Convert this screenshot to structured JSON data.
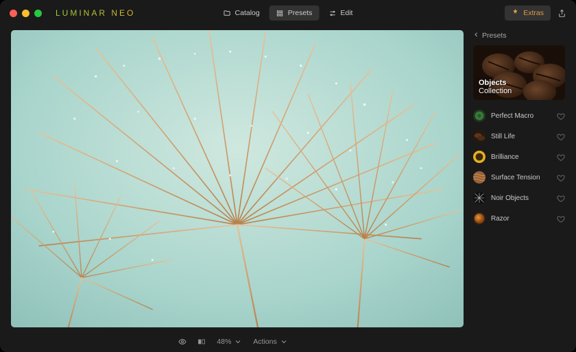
{
  "brand": "LUMINAR NEO",
  "nav": {
    "catalog": "Catalog",
    "presets": "Presets",
    "edit": "Edit",
    "extras": "Extras"
  },
  "status": {
    "zoom": "48%",
    "actions": "Actions"
  },
  "sidebar": {
    "crumb": "Presets",
    "hero": {
      "line1": "Objects",
      "line2": "Collection"
    },
    "presets": [
      {
        "name": "Perfect Macro"
      },
      {
        "name": "Still Life"
      },
      {
        "name": "Brilliance"
      },
      {
        "name": "Surface Tension"
      },
      {
        "name": "Noir Objects"
      },
      {
        "name": "Razor"
      }
    ]
  },
  "icons": {
    "eye": "eye-icon",
    "compare": "compare-icon",
    "folder": "folder-icon",
    "presets": "presets-icon",
    "sliders": "sliders-icon",
    "puzzle": "puzzle-icon",
    "share": "share-icon",
    "chevron_left": "chevron-left-icon",
    "chevron_down": "chevron-down-icon",
    "heart": "heart-icon"
  }
}
